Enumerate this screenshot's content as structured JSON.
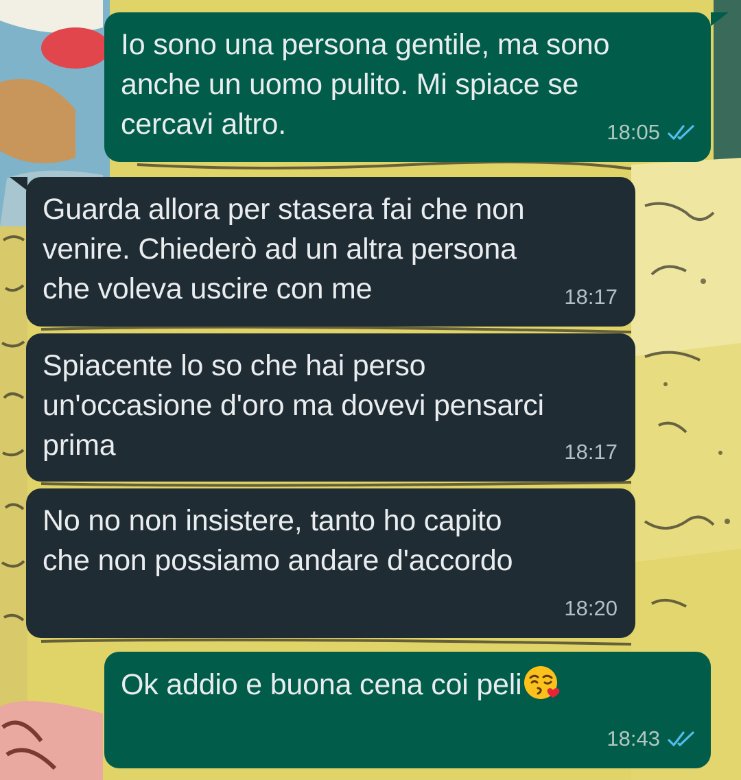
{
  "messages": [
    {
      "direction": "out",
      "text": "Io sono una persona gentile, ma sono\nanche un uomo pulito. Mi spiace se\ncercavi altro.",
      "time": "18:05",
      "status": "read"
    },
    {
      "direction": "in",
      "text": "Guarda allora per stasera fai che  non\nvenire. Chiederò ad un altra persona\nche voleva uscire con me",
      "time": "18:17"
    },
    {
      "direction": "in",
      "text": "Spiacente lo so che hai perso\nun'occasione d'oro ma dovevi pensarci\nprima",
      "time": "18:17"
    },
    {
      "direction": "in",
      "text": "No no non insistere, tanto ho capito\nche non possiamo andare d'accordo",
      "time": "18:20"
    },
    {
      "direction": "out",
      "text": "Ok addio e buona cena coi peli",
      "emoji": "face-blowing-a-kiss",
      "time": "18:43",
      "status": "read"
    }
  ],
  "colors": {
    "outgoing_bubble": "#025c4a",
    "incoming_bubble": "#202c33",
    "text": "#e9edef",
    "read_ticks": "#53bdeb"
  }
}
